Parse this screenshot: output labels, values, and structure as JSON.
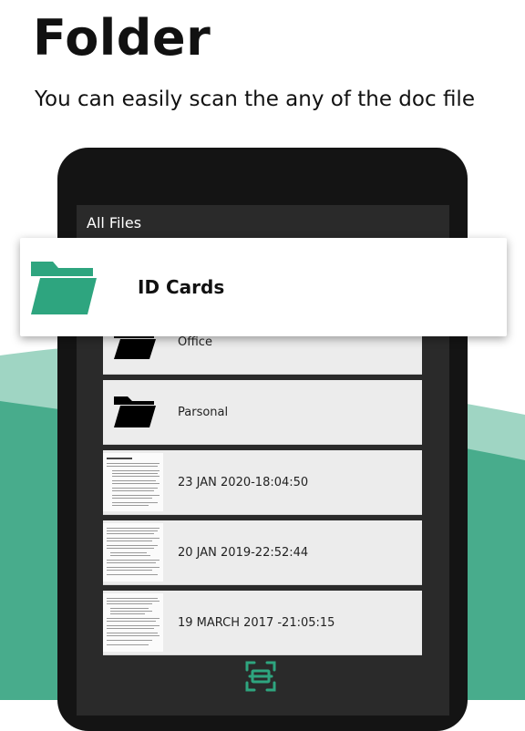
{
  "headline": "Folder",
  "subtitle": "You can easily scan the any of the  doc file",
  "app_bar": {
    "title": "All Files"
  },
  "highlight_card": {
    "label": "ID Cards",
    "icon": "folder-open-icon"
  },
  "files": [
    {
      "label": "Office",
      "icon": "folder-icon",
      "type": "folder"
    },
    {
      "label": "Parsonal",
      "icon": "folder-icon",
      "type": "folder"
    },
    {
      "label": "23 JAN 2020-18:04:50",
      "icon": "document-thumbnail",
      "type": "document"
    },
    {
      "label": "20 JAN 2019-22:52:44",
      "icon": "document-thumbnail",
      "type": "document"
    },
    {
      "label": "19 MARCH 2017 -21:05:15",
      "icon": "document-thumbnail",
      "type": "document"
    }
  ],
  "scan_button": {
    "icon": "scan-icon"
  },
  "colors": {
    "accent": "#2ea57f",
    "wave_light": "#9fd5c3",
    "wave_dark": "#48ac8c",
    "device": "#141414",
    "screen": "#2a2a2a",
    "list_item": "#ececec"
  }
}
